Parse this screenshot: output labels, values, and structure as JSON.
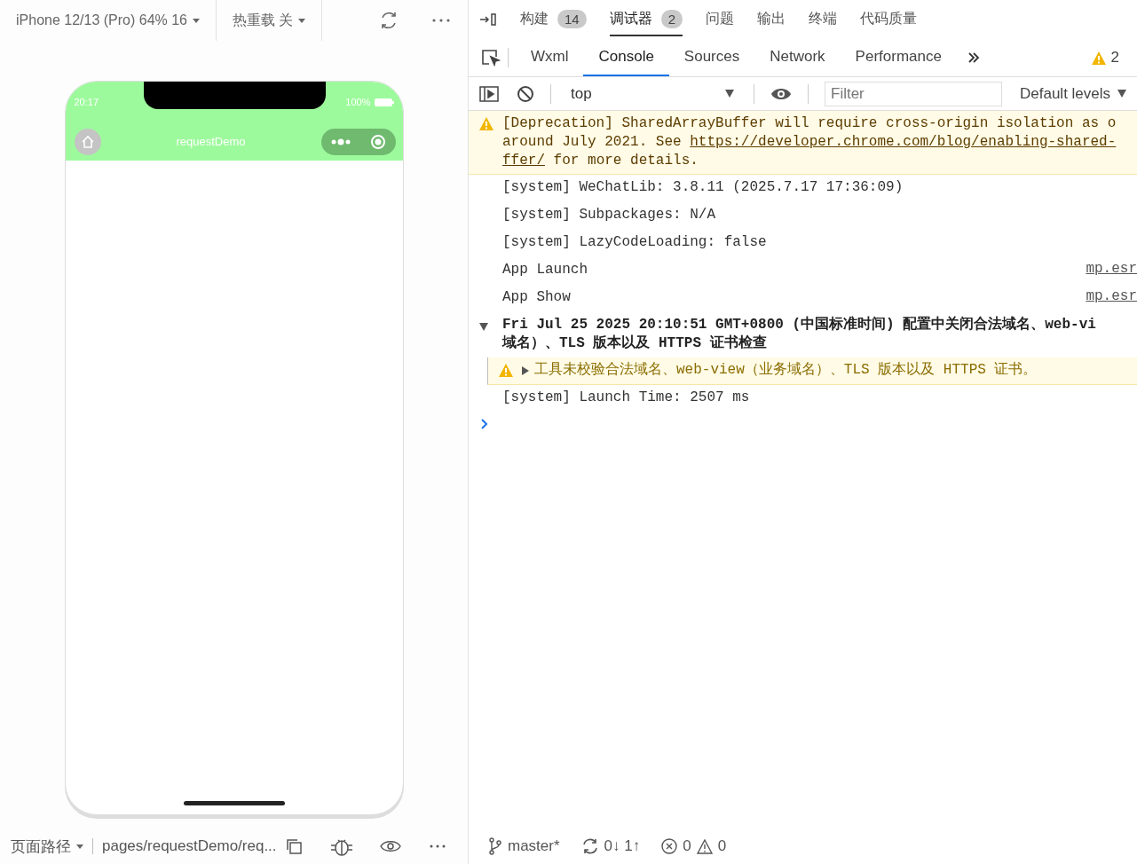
{
  "simulator": {
    "device": "iPhone 12/13 (Pro) 64% 16",
    "hot_reload": "热重载 关",
    "phone": {
      "time": "20:17",
      "battery": "100%",
      "title": "requestDemo"
    }
  },
  "bottom_bar": {
    "path_label": "页面路径",
    "path": "pages/requestDemo/req..."
  },
  "panel_tabs": [
    {
      "label": "构建",
      "count": "14",
      "selected": false
    },
    {
      "label": "调试器",
      "count": "2",
      "selected": true
    },
    {
      "label": "问题",
      "selected": false
    },
    {
      "label": "输出",
      "selected": false
    },
    {
      "label": "终端",
      "selected": false
    },
    {
      "label": "代码质量",
      "selected": false
    }
  ],
  "devtools_tabs": [
    {
      "label": "Wxml",
      "selected": false
    },
    {
      "label": "Console",
      "selected": true
    },
    {
      "label": "Sources",
      "selected": false
    },
    {
      "label": "Network",
      "selected": false
    },
    {
      "label": "Performance",
      "selected": false
    }
  ],
  "warning_count": "2",
  "console_toolbar": {
    "context": "top",
    "filter_placeholder": "Filter",
    "levels": "Default levels"
  },
  "messages": [
    {
      "kind": "warning",
      "lines": [
        [
          {
            "text": "[Deprecation] SharedArrayBuffer will require cross-origin isolation as o",
            "link": false
          }
        ],
        [
          {
            "text": "around July 2021. See ",
            "link": false
          },
          {
            "text": "https://developer.chrome.com/blog/enabling-shared-",
            "link": true
          }
        ],
        [
          {
            "text": "ffer/",
            "link": true
          },
          {
            "text": " for more details.",
            "link": false
          }
        ]
      ]
    },
    {
      "kind": "log",
      "lines": [
        [
          {
            "text": "[system] WeChatLib: 3.8.11 (2025.7.17 17:36:09)",
            "link": false
          }
        ]
      ]
    },
    {
      "kind": "log",
      "lines": [
        [
          {
            "text": "[system] Subpackages: N/A",
            "link": false
          }
        ]
      ]
    },
    {
      "kind": "log",
      "lines": [
        [
          {
            "text": "[system] LazyCodeLoading: false",
            "link": false
          }
        ]
      ]
    },
    {
      "kind": "log",
      "lines": [
        [
          {
            "text": "App Launch",
            "link": false
          }
        ]
      ],
      "source": "mp.esr"
    },
    {
      "kind": "log",
      "lines": [
        [
          {
            "text": "App Show",
            "link": false
          }
        ]
      ],
      "source": "mp.esr"
    },
    {
      "kind": "group",
      "expanded": true,
      "lines": [
        [
          {
            "text": "Fri Jul 25 2025 20:10:51 GMT+0800 (中国标准时间) 配置中关闭合法域名、web-vi",
            "link": false
          }
        ],
        [
          {
            "text": "域名）、TLS 版本以及 HTTPS 证书检查",
            "link": false
          }
        ]
      ]
    },
    {
      "kind": "nested_warning",
      "expanded": false,
      "lines": [
        [
          {
            "text": "工具未校验合法域名、web-view（业务域名）、TLS 版本以及 HTTPS 证书。",
            "link": false
          }
        ]
      ]
    },
    {
      "kind": "log",
      "lines": [
        [
          {
            "text": "[system] Launch Time: 2507 ms",
            "link": false
          }
        ]
      ]
    }
  ],
  "status": {
    "branch": "master*",
    "sync": "0↓ 1↑",
    "errors": "0",
    "warnings": "0"
  }
}
